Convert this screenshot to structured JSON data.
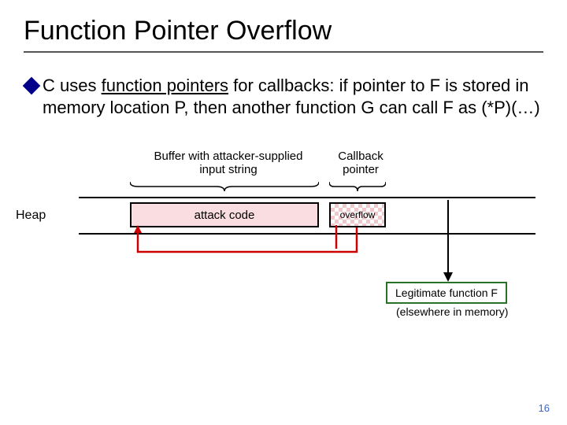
{
  "title": "Function Pointer Overflow",
  "bullet": {
    "pre": "C uses ",
    "underlined": "function pointers",
    "post": " for callbacks: if pointer to F is stored in memory location P, then another function G can call F as (*P)(…)"
  },
  "labels": {
    "buffer_l1": "Buffer with attacker-supplied",
    "buffer_l2": "input string",
    "callback_l1": "Callback",
    "callback_l2": "pointer",
    "heap": "Heap",
    "attack": "attack code",
    "overflow": "overflow",
    "legit": "Legitimate function F",
    "elsewhere": "(elsewhere in memory)"
  },
  "page": "16"
}
